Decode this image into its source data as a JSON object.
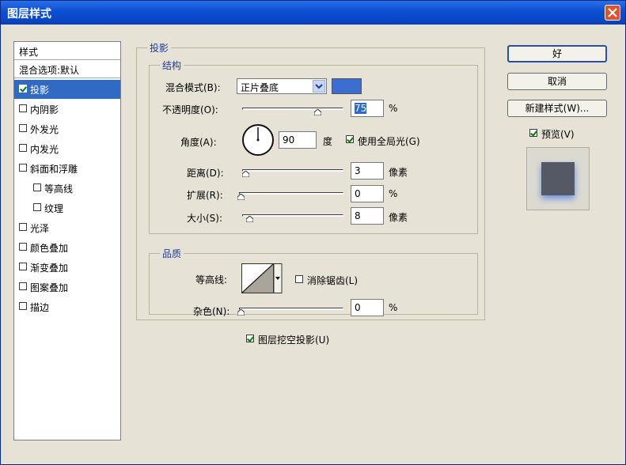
{
  "window": {
    "title": "图层样式"
  },
  "sidebar": {
    "header": "样式",
    "blend_options": "混合选项:默认",
    "items": [
      {
        "label": "投影",
        "checked": true,
        "selected": true
      },
      {
        "label": "内阴影",
        "checked": false
      },
      {
        "label": "外发光",
        "checked": false
      },
      {
        "label": "内发光",
        "checked": false
      },
      {
        "label": "斜面和浮雕",
        "checked": false
      },
      {
        "label": "等高线",
        "checked": false
      },
      {
        "label": "纹理",
        "checked": false
      },
      {
        "label": "光泽",
        "checked": false
      },
      {
        "label": "颜色叠加",
        "checked": false
      },
      {
        "label": "渐变叠加",
        "checked": false
      },
      {
        "label": "图案叠加",
        "checked": false
      },
      {
        "label": "描边",
        "checked": false
      }
    ]
  },
  "drop_shadow": {
    "title": "投影",
    "structure": {
      "title": "结构",
      "blend_mode_label": "混合模式(B):",
      "blend_mode_value": "正片叠底",
      "shadow_color": "#3b6ed0",
      "opacity_label": "不透明度(O):",
      "opacity_value": "75",
      "opacity_unit": "%",
      "angle_label": "角度(A):",
      "angle_value": "90",
      "angle_unit": "度",
      "global_light_label": "使用全局光(G)",
      "global_light_checked": true,
      "distance_label": "距离(D):",
      "distance_value": "3",
      "distance_unit": "像素",
      "spread_label": "扩展(R):",
      "spread_value": "0",
      "spread_unit": "%",
      "size_label": "大小(S):",
      "size_value": "8",
      "size_unit": "像素"
    },
    "quality": {
      "title": "品质",
      "contour_label": "等高线:",
      "antialias_label": "消除锯齿(L)",
      "antialias_checked": false,
      "noise_label": "杂色(N):",
      "noise_value": "0",
      "noise_unit": "%"
    },
    "knockout_label": "图层挖空投影(U)",
    "knockout_checked": true
  },
  "buttons": {
    "ok": "好",
    "cancel": "取消",
    "new_style": "新建样式(W)...",
    "preview_label": "预览(V)",
    "preview_checked": true
  }
}
